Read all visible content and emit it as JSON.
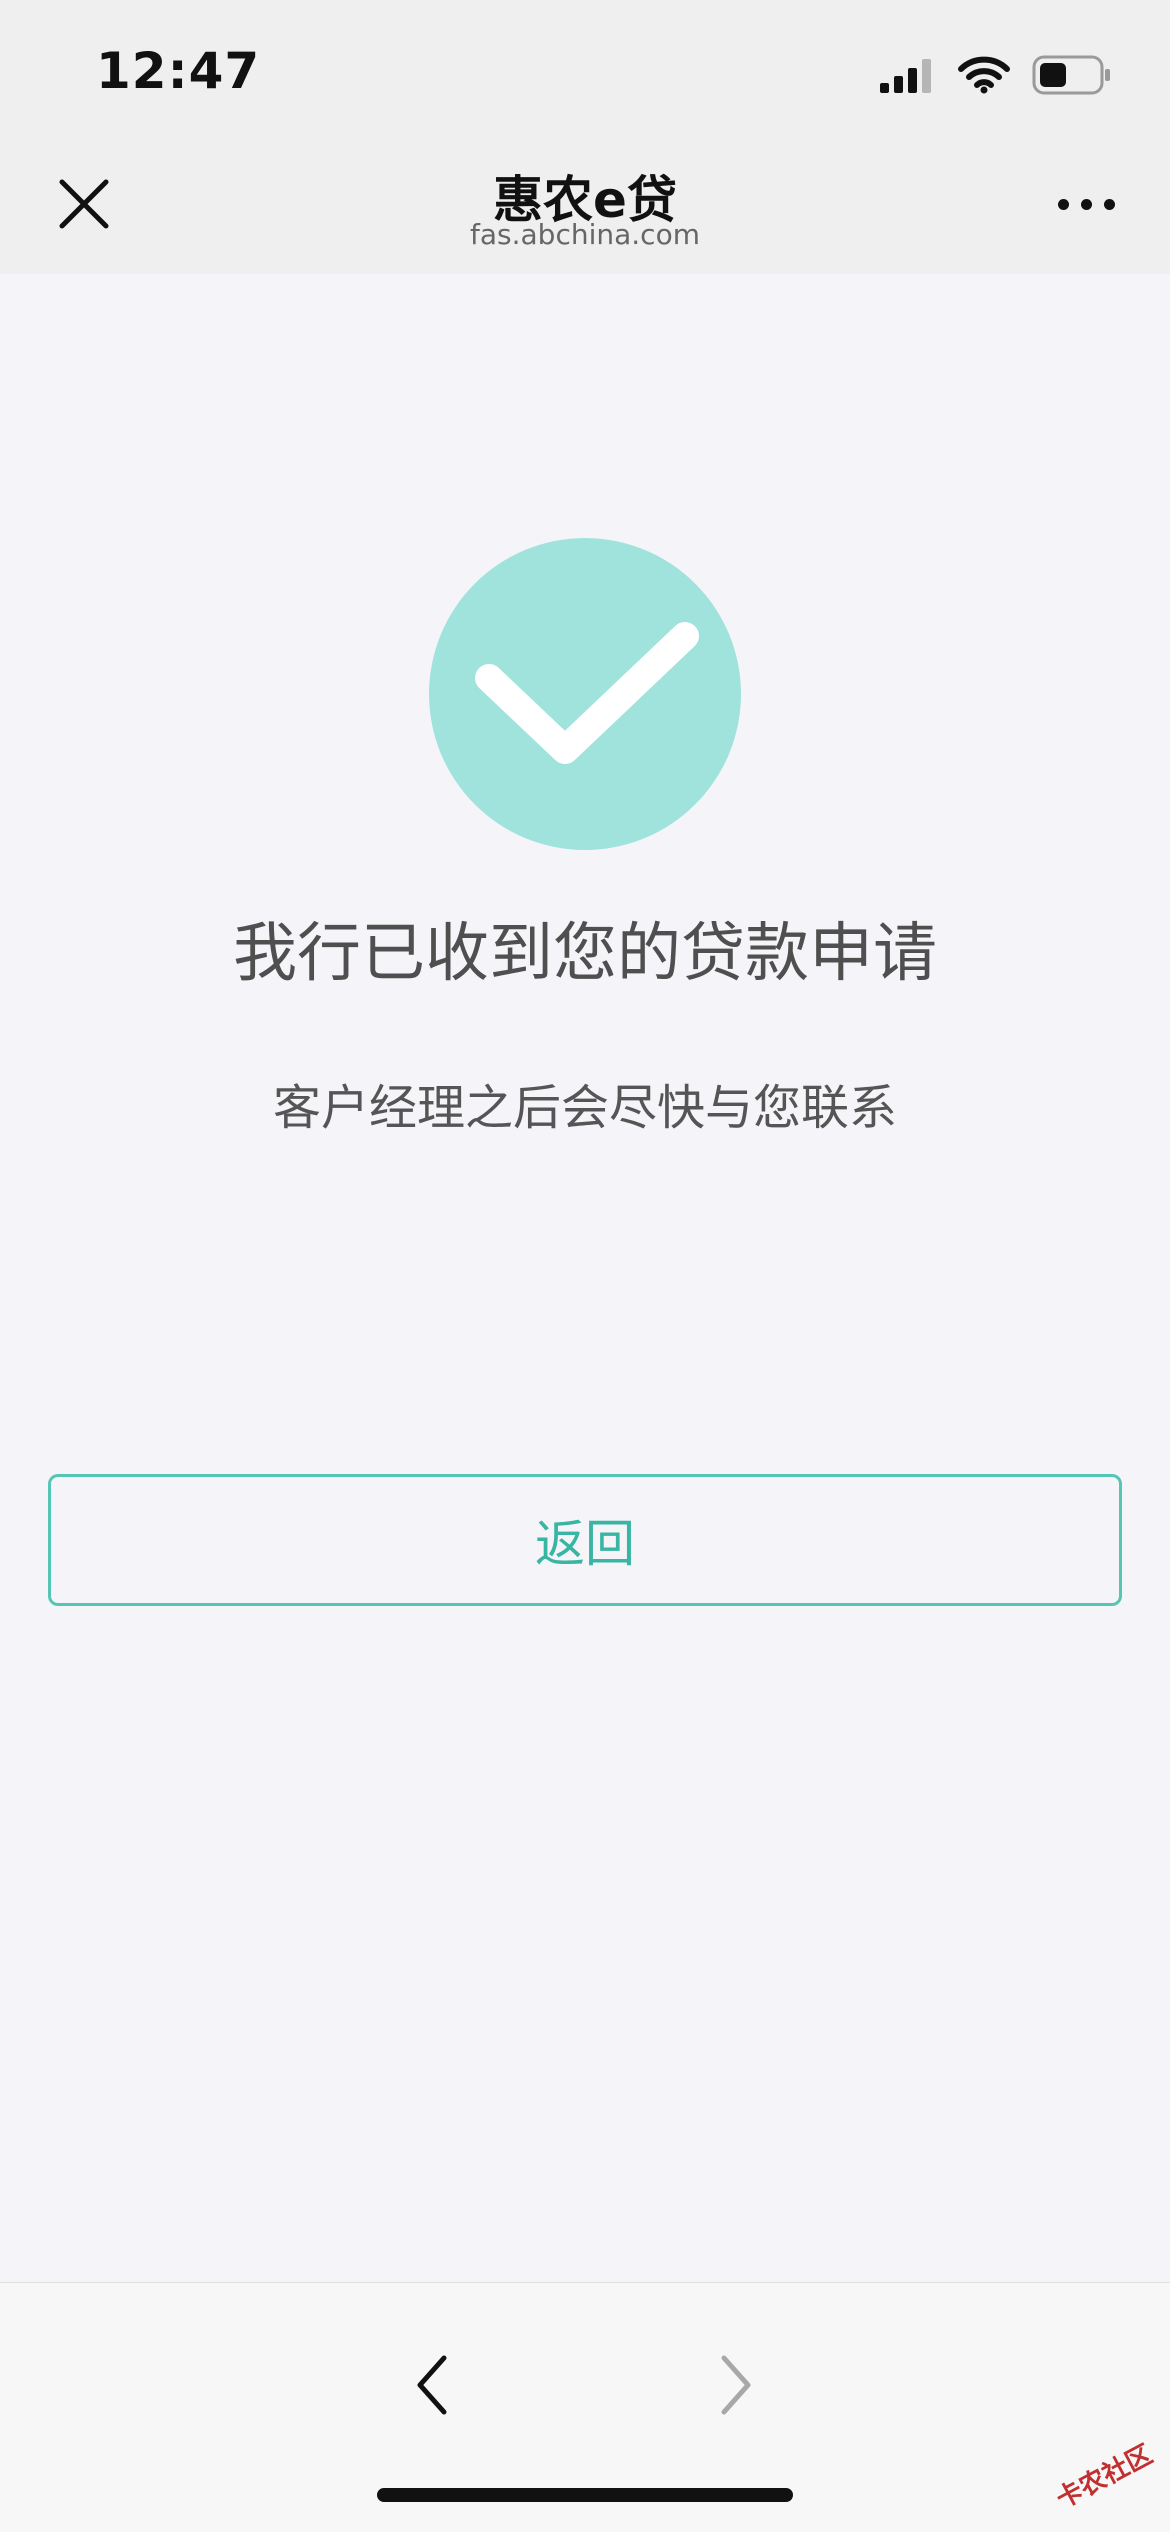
{
  "status_bar": {
    "time": "12:47"
  },
  "header": {
    "title": "惠农e贷",
    "subtitle": "fas.abchina.com"
  },
  "content": {
    "main_message": "我行已收到您的贷款申请",
    "sub_message": "客户经理之后会尽快与您联系",
    "back_label": "返回"
  },
  "colors": {
    "success_circle": "#a0e3dd",
    "button_border": "#56c6b4",
    "button_text": "#38b5a3"
  },
  "icons": {
    "close": "close-icon",
    "more": "more-icon",
    "success": "checkmark-icon",
    "nav_back": "chevron-left-icon",
    "nav_forward": "chevron-right-icon"
  },
  "watermark": {
    "text": "卡农社区"
  }
}
